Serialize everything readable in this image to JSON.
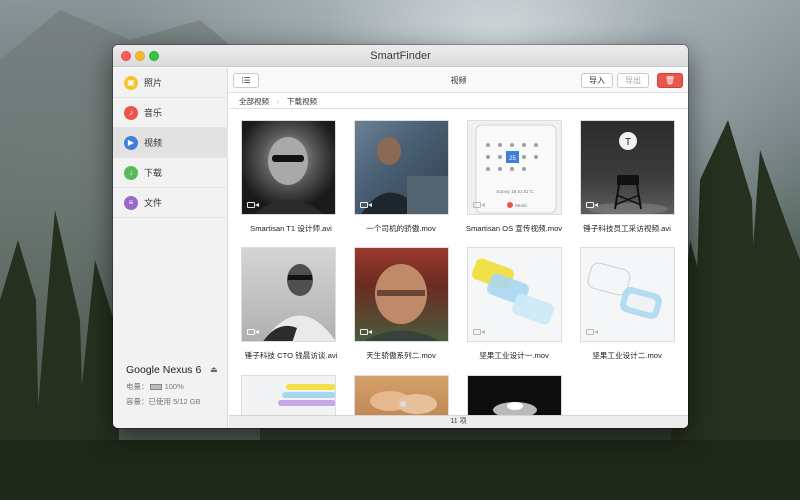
{
  "window": {
    "title": "SmartFinder"
  },
  "sidebar": {
    "items": [
      {
        "label": "照片",
        "icon": "photos-icon",
        "color": "#f4c430"
      },
      {
        "label": "音乐",
        "icon": "music-icon",
        "color": "#e8564e"
      },
      {
        "label": "视频",
        "icon": "video-icon",
        "color": "#3f7fd9"
      },
      {
        "label": "下载",
        "icon": "download-icon",
        "color": "#5cb85c"
      },
      {
        "label": "文件",
        "icon": "document-icon",
        "color": "#9a68c9"
      }
    ],
    "selected": "视频",
    "device": {
      "name": "Google Nexus 6",
      "battery_label": "电量：",
      "battery_value": "100%",
      "storage_label": "容量：已使用",
      "storage_value": "5/12 GB"
    }
  },
  "toolbar": {
    "title": "视频",
    "import_label": "导入",
    "export_label": "导出"
  },
  "pathbar": {
    "tabs": [
      "全部视频",
      "下载视频"
    ]
  },
  "files": [
    {
      "name": "Smartisan T1 设计师.avi"
    },
    {
      "name": "一个司机的骄傲.mov"
    },
    {
      "name": "Smartisan OS 宣传视频.mov",
      "thumb_text": {
        "date": "25",
        "sunny": "Sunny 18 to 31°C",
        "music": "Music"
      }
    },
    {
      "name": "锤子科技员工采访视频.avi",
      "thumb_text": {
        "logo": "T"
      }
    },
    {
      "name": "锤子科技 CTO 钱晨访谈.avi"
    },
    {
      "name": "天生骄傲系列二.mov"
    },
    {
      "name": "坚果工业设计一.mov"
    },
    {
      "name": "坚果工业设计二.mov"
    },
    {
      "name": ""
    },
    {
      "name": ""
    },
    {
      "name": ""
    }
  ],
  "status": {
    "count": "11 项"
  }
}
